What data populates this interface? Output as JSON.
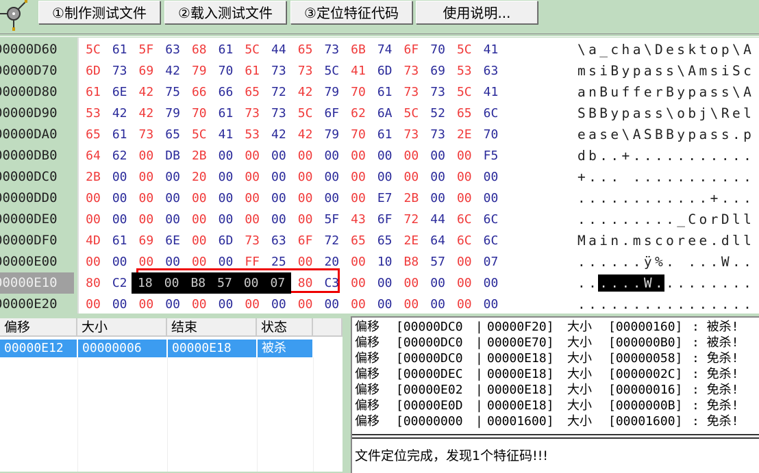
{
  "toolbar": {
    "buttons": [
      "①制作测试文件",
      "②载入测试文件",
      "③定位特征代码",
      "使用说明..."
    ]
  },
  "hex": {
    "rows": [
      {
        "offset": "00000D60",
        "bytes": "5C 61 5F 63 68 61 5C 44 65 73 6B 74 6F 70 5C 41",
        "ascii": "\\a_cha\\Desktop\\A"
      },
      {
        "offset": "00000D70",
        "bytes": "6D 73 69 42 79 70 61 73 73 5C 41 6D 73 69 53 63",
        "ascii": "msiBypass\\AmsiSc"
      },
      {
        "offset": "00000D80",
        "bytes": "61 6E 42 75 66 66 65 72 42 79 70 61 73 73 5C 41",
        "ascii": "anBufferBypass\\A"
      },
      {
        "offset": "00000D90",
        "bytes": "53 42 42 79 70 61 73 73 5C 6F 62 6A 5C 52 65 6C",
        "ascii": "SBBypass\\obj\\Rel"
      },
      {
        "offset": "00000DA0",
        "bytes": "65 61 73 65 5C 41 53 42 42 79 70 61 73 73 2E 70",
        "ascii": "ease\\ASBBypass.p"
      },
      {
        "offset": "00000DB0",
        "bytes": "64 62 00 DB 2B 00 00 00 00 00 00 00 00 00 00 F5",
        "ascii": "db..+..........."
      },
      {
        "offset": "00000DC0",
        "bytes": "2B 00 00 00 20 00 00 00 00 00 00 00 00 00 00 00",
        "ascii": "+... ..........."
      },
      {
        "offset": "00000DD0",
        "bytes": "00 00 00 00 00 00 00 00 00 00 00 E7 2B 00 00 00",
        "ascii": "............+..."
      },
      {
        "offset": "00000DE0",
        "bytes": "00 00 00 00 00 00 00 00 00 5F 43 6F 72 44 6C 6C",
        "ascii": "........._CorDll"
      },
      {
        "offset": "00000DF0",
        "bytes": "4D 61 69 6E 00 6D 73 63 6F 72 65 65 2E 64 6C 6C",
        "ascii": "Main.mscoree.dll"
      },
      {
        "offset": "00000E00",
        "bytes": "00 00 00 00 00 00 FF 25 00 20 00 10 B8 57 00 07",
        "ascii": "......ÿ%. ...W.."
      },
      {
        "offset": "00000E10",
        "bytes": "80 C2 18 00 B8 57 00 07 80 C3 00 00 00 00 00 00",
        "ascii": "......W........."
      },
      {
        "offset": "00000E20",
        "bytes": "00 00 00 00 00 00 00 00 00 00 00 00 00 00 00 00",
        "ascii": "................"
      }
    ],
    "selected_row": 11,
    "highlight_start": 2,
    "highlight_len": 6
  },
  "table": {
    "headers": [
      "偏移",
      "大小",
      "结束",
      "状态"
    ],
    "rows": [
      [
        "00000E12",
        "00000006",
        "00000E18",
        "被杀"
      ]
    ]
  },
  "log": {
    "lines": [
      [
        "偏移",
        "[00000DC0",
        "00000F20]",
        "大小",
        "[00000160]",
        ": 被杀!"
      ],
      [
        "偏移",
        "[00000DC0",
        "00000E70]",
        "大小",
        "[000000B0]",
        ": 被杀!"
      ],
      [
        "偏移",
        "[00000DC0",
        "00000E18]",
        "大小",
        "[00000058]",
        ": 免杀!"
      ],
      [
        "偏移",
        "[00000DEC",
        "00000E18]",
        "大小",
        "[0000002C]",
        ": 免杀!"
      ],
      [
        "偏移",
        "[00000E02",
        "00000E18]",
        "大小",
        "[00000016]",
        ": 免杀!"
      ],
      [
        "偏移",
        "[00000E0D",
        "00000E18]",
        "大小",
        "[0000000B]",
        ": 免杀!"
      ],
      [
        "偏移",
        "[00000000",
        "00001600]",
        "大小",
        "[00001600]",
        ": 免杀!"
      ]
    ],
    "status": "文件定位完成，发现1个特征码!!!"
  }
}
